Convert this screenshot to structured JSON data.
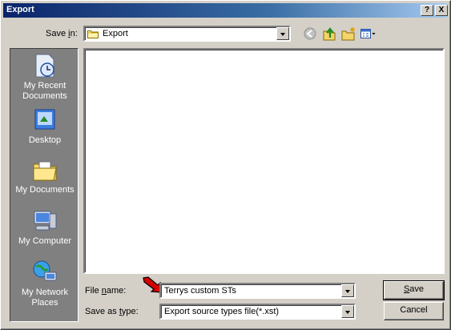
{
  "window": {
    "title": "Export",
    "help_glyph": "?",
    "close_glyph": "X"
  },
  "save_in": {
    "label_pre": "Save ",
    "label_key": "i",
    "label_post": "n:",
    "value": "Export"
  },
  "toolbar": {
    "icons": [
      "back-icon",
      "up-folder-icon",
      "new-folder-icon",
      "view-menu-icon"
    ]
  },
  "places": {
    "items": [
      {
        "id": "recent",
        "line1": "My Recent",
        "line2": "Documents",
        "icon": "recent-documents-icon"
      },
      {
        "id": "desktop",
        "line1": "Desktop",
        "line2": "",
        "icon": "desktop-icon"
      },
      {
        "id": "documents",
        "line1": "My Documents",
        "line2": "",
        "icon": "my-documents-icon"
      },
      {
        "id": "computer",
        "line1": "My Computer",
        "line2": "",
        "icon": "my-computer-icon"
      },
      {
        "id": "network",
        "line1": "My Network",
        "line2": "Places",
        "icon": "network-places-icon"
      }
    ]
  },
  "file_name": {
    "label_pre": "File ",
    "label_key": "n",
    "label_post": "ame:",
    "value": "Terrys custom STs"
  },
  "save_as_type": {
    "label_pre": "Save as ",
    "label_key": "t",
    "label_post": "ype:",
    "value": "Export source types file(*.xst)"
  },
  "buttons": {
    "save_key": "S",
    "save_rest": "ave",
    "cancel": "Cancel"
  },
  "colors": {
    "title_start": "#0a246a",
    "title_end": "#a6caf0",
    "face": "#d4d0c8",
    "places_bg": "#808080",
    "arrow": "#d40000"
  }
}
